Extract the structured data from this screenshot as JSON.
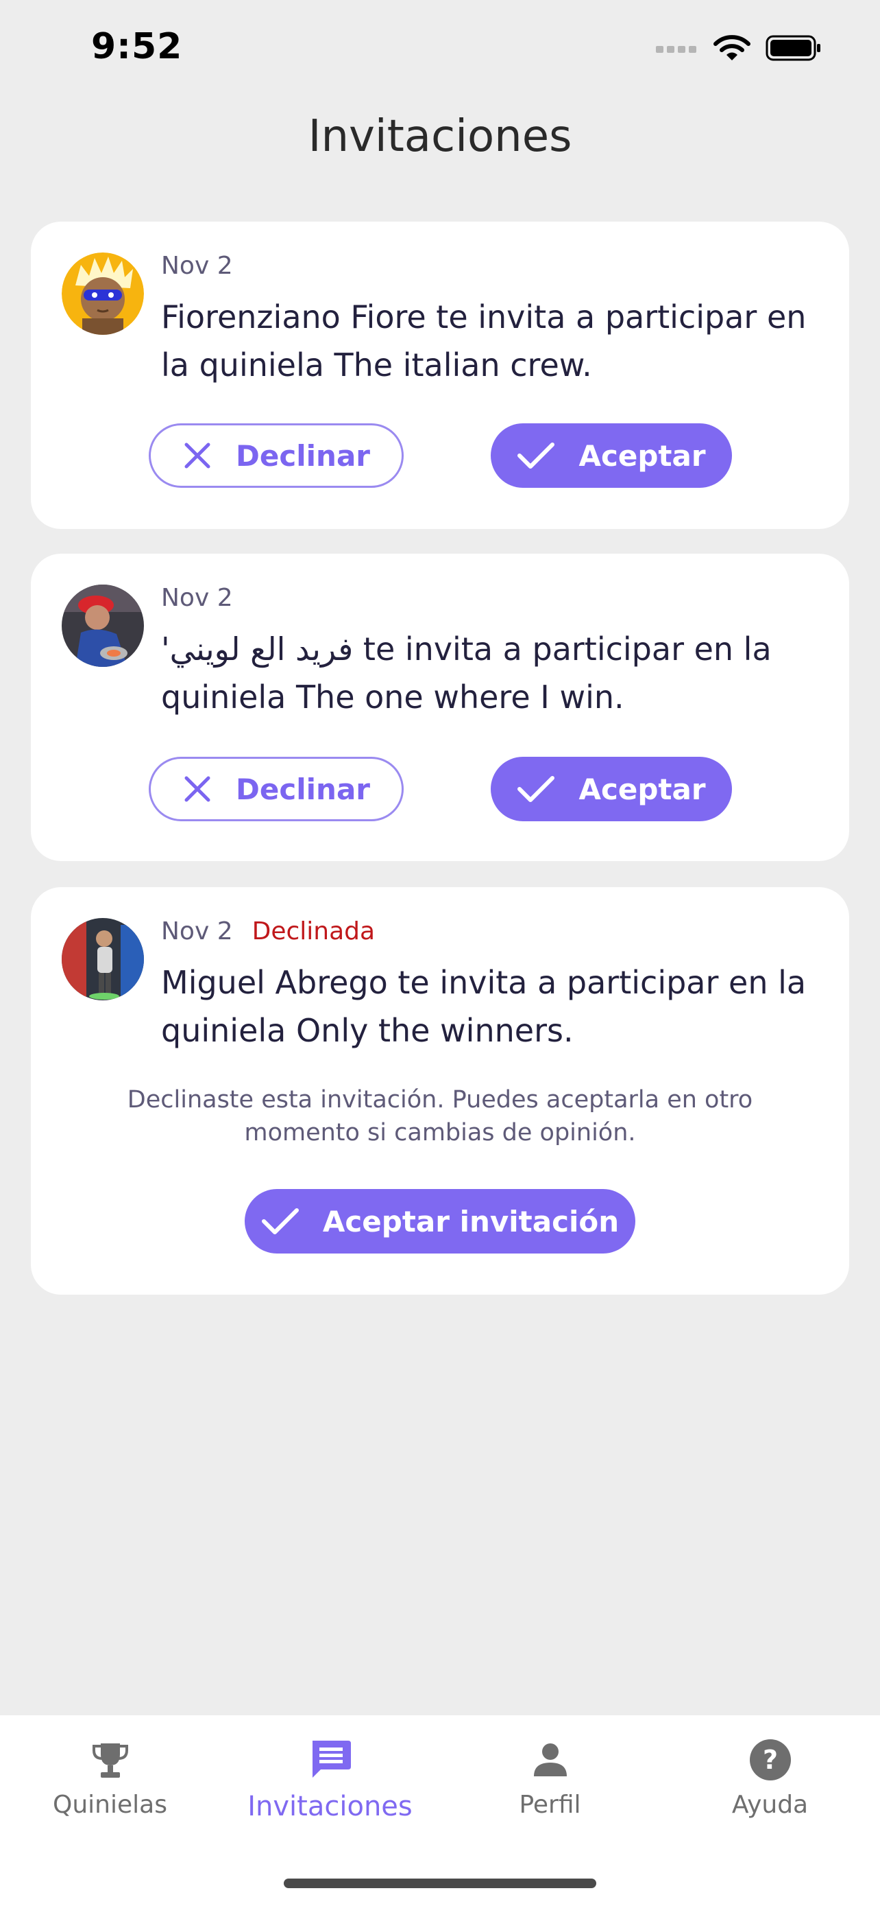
{
  "status_bar": {
    "time": "9:52"
  },
  "header": {
    "title": "Invitaciones"
  },
  "invitations": [
    {
      "date": "Nov 2",
      "message": "Fiorenziano Fiore te invita a participar en la quiniela The italian crew.",
      "decline_label": "Declinar",
      "accept_label": "Aceptar"
    },
    {
      "date": "Nov 2",
      "message": "'فريد الع لويني te invita a participar en la quiniela The one where I win.",
      "decline_label": "Declinar",
      "accept_label": "Aceptar"
    },
    {
      "date": "Nov 2",
      "status": "Declinada",
      "message": "Miguel Abrego te invita a participar en la quiniela Only the winners.",
      "note": "Declinaste esta invitación. Puedes aceptarla en otro momento si cambias de opinión.",
      "accept_label": "Aceptar invitación"
    }
  ],
  "tabs": [
    {
      "label": "Quinielas",
      "icon": "trophy-icon"
    },
    {
      "label": "Invitaciones",
      "icon": "message-icon",
      "active": true
    },
    {
      "label": "Perfil",
      "icon": "person-icon"
    },
    {
      "label": "Ayuda",
      "icon": "help-icon"
    }
  ],
  "colors": {
    "accent": "#7f69f1",
    "declined": "#c0181b",
    "background": "#ededed"
  }
}
